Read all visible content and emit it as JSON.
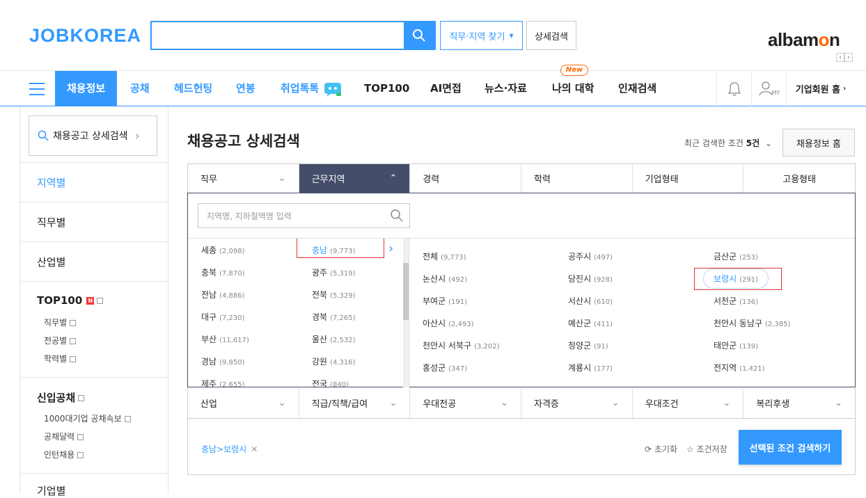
{
  "header": {
    "logo": "JOBKOREA",
    "search_placeholder": "",
    "job_loc_label": "직무·지역 찾기",
    "detail_label": "상세검색",
    "albamon": {
      "pre": "albam",
      "o": "o",
      "post": "n"
    }
  },
  "nav": {
    "items": [
      "채용정보",
      "공채",
      "헤드헌팅",
      "연봉",
      "취업톡톡",
      "TOP100",
      "AI면접",
      "뉴스·자료",
      "나의 대학",
      "인재검색"
    ],
    "new_badge": "New",
    "my_label": "MY",
    "corp_home": "기업회원 홈"
  },
  "sidebar": {
    "search_label": "채용공고 상세검색",
    "sections": [
      "지역별",
      "직무별",
      "산업별",
      "TOP100",
      "신입공채",
      "기업별"
    ],
    "top100_badge": "N",
    "top100_sub": [
      "직무별",
      "전공별",
      "학력별"
    ],
    "newgrad_sub": [
      "1000대기업 공채속보",
      "공채달력",
      "인턴채용"
    ]
  },
  "main": {
    "title": "채용공고 상세검색",
    "recent_prefix": "최근 검색한 조건 ",
    "recent_count": "5건",
    "home_button": "채용정보 홈",
    "tabs_top": [
      "직무",
      "근무지역",
      "경력",
      "학력",
      "기업형태",
      "고용형태"
    ],
    "location_placeholder": "지역명, 지하철역명 입력",
    "regions_left": [
      {
        "name": "세종",
        "count": "(2,098)"
      },
      {
        "name": "충북",
        "count": "(7,870)"
      },
      {
        "name": "전남",
        "count": "(4,886)"
      },
      {
        "name": "대구",
        "count": "(7,230)"
      },
      {
        "name": "부산",
        "count": "(11,617)"
      },
      {
        "name": "경남",
        "count": "(9,850)"
      },
      {
        "name": "제주",
        "count": "(2,655)"
      }
    ],
    "regions_right": [
      {
        "name": "충남",
        "count": "(9,773)"
      },
      {
        "name": "광주",
        "count": "(5,319)"
      },
      {
        "name": "전북",
        "count": "(5,329)"
      },
      {
        "name": "경북",
        "count": "(7,265)"
      },
      {
        "name": "울산",
        "count": "(2,532)"
      },
      {
        "name": "강원",
        "count": "(4,316)"
      },
      {
        "name": "전국",
        "count": "(840)"
      }
    ],
    "cities": [
      {
        "name": "전체",
        "count": "(9,773)"
      },
      {
        "name": "공주시",
        "count": "(497)"
      },
      {
        "name": "금산군",
        "count": "(253)"
      },
      {
        "name": "논산시",
        "count": "(492)"
      },
      {
        "name": "당진시",
        "count": "(928)"
      },
      {
        "name": "보령시",
        "count": "(291)"
      },
      {
        "name": "부여군",
        "count": "(191)"
      },
      {
        "name": "서산시",
        "count": "(610)"
      },
      {
        "name": "서천군",
        "count": "(136)"
      },
      {
        "name": "아산시",
        "count": "(2,493)"
      },
      {
        "name": "예산군",
        "count": "(411)"
      },
      {
        "name": "천안시 동남구",
        "count": "(2,385)"
      },
      {
        "name": "천안시 서북구",
        "count": "(3,202)"
      },
      {
        "name": "청양군",
        "count": "(91)"
      },
      {
        "name": "태안군",
        "count": "(139)"
      },
      {
        "name": "홍성군",
        "count": "(347)"
      },
      {
        "name": "계룡시",
        "count": "(177)"
      },
      {
        "name": "전지역",
        "count": "(1,421)"
      }
    ],
    "tabs_bottom": [
      "산업",
      "직급/직책/급여",
      "우대전공",
      "자격증",
      "우대조건",
      "복리후생"
    ],
    "selected_chip": "충남>보령시",
    "reset_label": "초기화",
    "save_label": "조건저장",
    "submit_label": "선택된 조건 검색하기"
  },
  "colors": {
    "accent": "#3399ff",
    "tab_active": "#444d6a",
    "highlight": "#e03030",
    "albamon_o": "#ff6600"
  }
}
